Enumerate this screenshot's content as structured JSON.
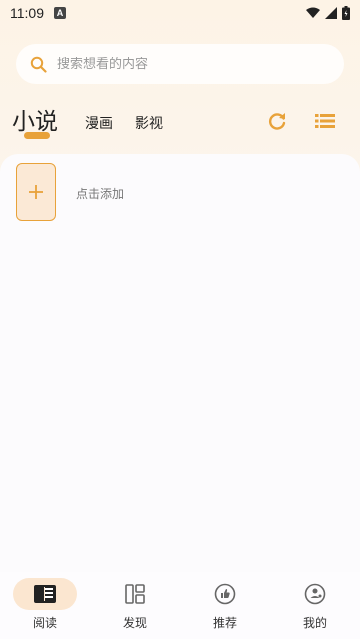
{
  "status": {
    "time": "11:09",
    "notif_letter": "A"
  },
  "search": {
    "placeholder": "搜索想看的内容"
  },
  "tabs": [
    {
      "label": "小说",
      "active": true
    },
    {
      "label": "漫画",
      "active": false
    },
    {
      "label": "影视",
      "active": false
    }
  ],
  "content": {
    "add_label": "点击添加"
  },
  "nav": [
    {
      "label": "阅读",
      "icon": "book-icon",
      "active": true
    },
    {
      "label": "发现",
      "icon": "grid-icon",
      "active": false
    },
    {
      "label": "推荐",
      "icon": "thumb-up-icon",
      "active": false
    },
    {
      "label": "我的",
      "icon": "profile-icon",
      "active": false
    }
  ],
  "colors": {
    "accent": "#e8a23a",
    "accent_light": "#fbe9d6"
  }
}
